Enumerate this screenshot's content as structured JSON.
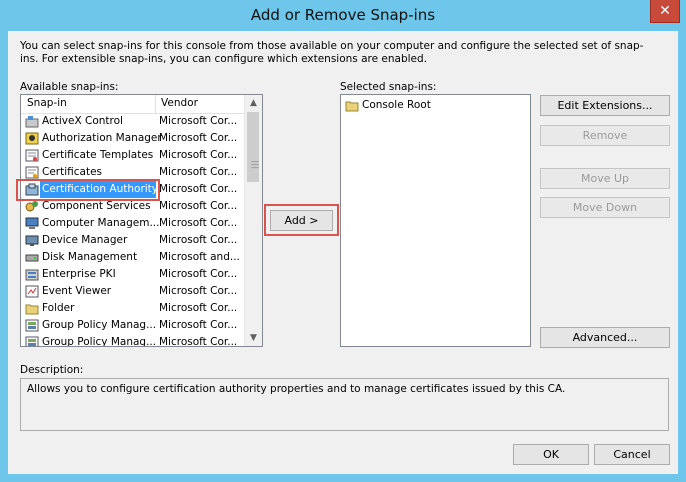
{
  "window": {
    "title": "Add or Remove Snap-ins",
    "close_glyph": "✕"
  },
  "intro_text": "You can select snap-ins for this console from those available on your computer and configure the selected set of snap-ins. For extensible snap-ins, you can configure which extensions are enabled.",
  "available": {
    "label": "Available snap-ins:",
    "columns": [
      "Snap-in",
      "Vendor"
    ],
    "selected_index": 4,
    "items": [
      {
        "name": "ActiveX Control",
        "vendor": "Microsoft Cor...",
        "icon": "activex-icon"
      },
      {
        "name": "Authorization Manager",
        "vendor": "Microsoft Cor...",
        "icon": "authorization-icon"
      },
      {
        "name": "Certificate Templates",
        "vendor": "Microsoft Cor...",
        "icon": "certificate-templates-icon"
      },
      {
        "name": "Certificates",
        "vendor": "Microsoft Cor...",
        "icon": "certificates-icon"
      },
      {
        "name": "Certification Authority",
        "vendor": "Microsoft Cor...",
        "icon": "certification-authority-icon"
      },
      {
        "name": "Component Services",
        "vendor": "Microsoft Cor...",
        "icon": "component-services-icon"
      },
      {
        "name": "Computer Managem...",
        "vendor": "Microsoft Cor...",
        "icon": "computer-management-icon"
      },
      {
        "name": "Device Manager",
        "vendor": "Microsoft Cor...",
        "icon": "device-manager-icon"
      },
      {
        "name": "Disk Management",
        "vendor": "Microsoft and...",
        "icon": "disk-management-icon"
      },
      {
        "name": "Enterprise PKI",
        "vendor": "Microsoft Cor...",
        "icon": "enterprise-pki-icon"
      },
      {
        "name": "Event Viewer",
        "vendor": "Microsoft Cor...",
        "icon": "event-viewer-icon"
      },
      {
        "name": "Folder",
        "vendor": "Microsoft Cor...",
        "icon": "folder-icon"
      },
      {
        "name": "Group Policy Manag...",
        "vendor": "Microsoft Cor...",
        "icon": "group-policy-icon"
      },
      {
        "name": "Group Policy Manag...",
        "vendor": "Microsoft Cor...",
        "icon": "group-policy-icon"
      }
    ]
  },
  "add_button": "Add >",
  "selected": {
    "label": "Selected snap-ins:",
    "items": [
      {
        "name": "Console Root",
        "icon": "folder-icon"
      }
    ]
  },
  "buttons": {
    "edit_extensions": "Edit Extensions...",
    "remove": "Remove",
    "move_up": "Move Up",
    "move_down": "Move Down",
    "advanced": "Advanced...",
    "ok": "OK",
    "cancel": "Cancel"
  },
  "description": {
    "label": "Description:",
    "text": "Allows you to configure certification authority  properties and to manage certificates issued by this CA."
  },
  "colors": {
    "titlebar": "#6ec6ea",
    "selection": "#3399ff",
    "highlight_border": "#d9534f",
    "close_button": "#c74a3a"
  }
}
